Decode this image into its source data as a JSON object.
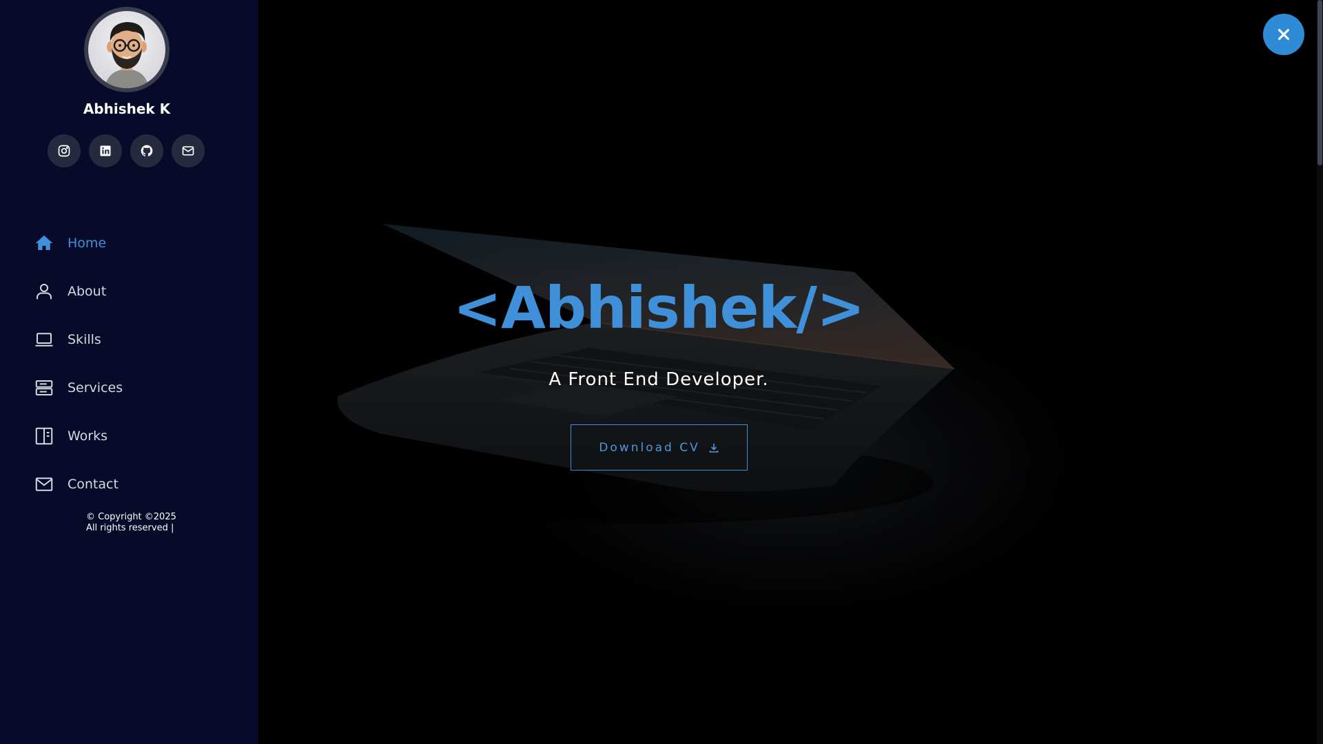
{
  "profile": {
    "name": "Abhishek K",
    "avatar_icon": "memoji-avatar"
  },
  "socials": [
    {
      "icon": "instagram-icon"
    },
    {
      "icon": "linkedin-icon"
    },
    {
      "icon": "github-icon"
    },
    {
      "icon": "mail-icon"
    }
  ],
  "nav": {
    "items": [
      {
        "label": "Home",
        "icon": "home-icon",
        "active": true
      },
      {
        "label": "About",
        "icon": "user-icon",
        "active": false
      },
      {
        "label": "Skills",
        "icon": "laptop-icon",
        "active": false
      },
      {
        "label": "Services",
        "icon": "server-icon",
        "active": false
      },
      {
        "label": "Works",
        "icon": "columns-icon",
        "active": false
      },
      {
        "label": "Contact",
        "icon": "envelope-icon",
        "active": false
      }
    ]
  },
  "footer": {
    "copyright_line1": "© Copyright ©2025",
    "copyright_line2": "All rights reserved |"
  },
  "hero": {
    "headline": "<Abhishek/>",
    "subtitle": "A Front End Developer.",
    "download_label": "Download CV"
  },
  "colors": {
    "sidebar_bg": "#070a29",
    "accent": "#3f8fd9",
    "close_button": "#2f8bd5"
  }
}
